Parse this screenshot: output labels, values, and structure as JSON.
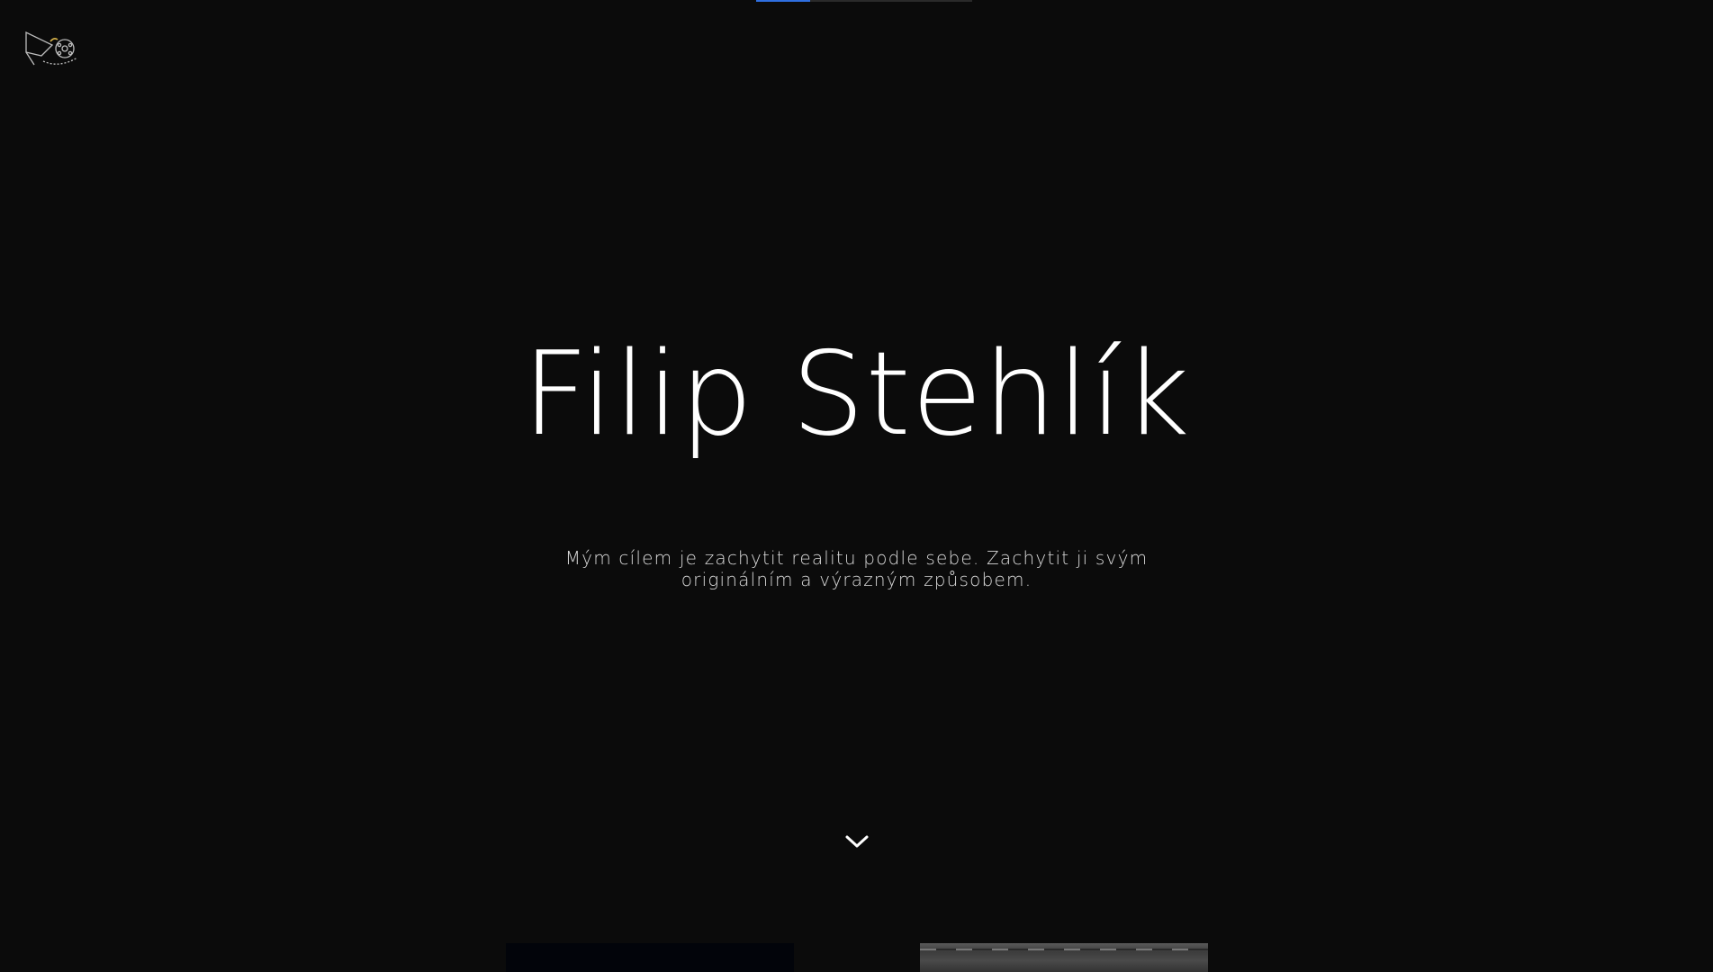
{
  "progress": {
    "fraction": 0.25,
    "accent_color": "#2f6fe0",
    "track_color": "#2a2a2a"
  },
  "logo": {
    "icon": "film-camera-icon"
  },
  "hero": {
    "title": "Filip Stehlík",
    "subtitle": "Mým cílem je zachytit realitu podle sebe. Zachytit ji svým originálním a výrazným způsobem."
  },
  "scroll": {
    "icon": "chevron-down-icon"
  },
  "gallery": {
    "items": [
      {
        "name": "gallery-thumbnail-1"
      },
      {
        "name": "gallery-thumbnail-2"
      }
    ]
  },
  "colors": {
    "background": "#0b0b0b",
    "text": "#ffffff",
    "subtitle_text": "#d9d9d9"
  }
}
